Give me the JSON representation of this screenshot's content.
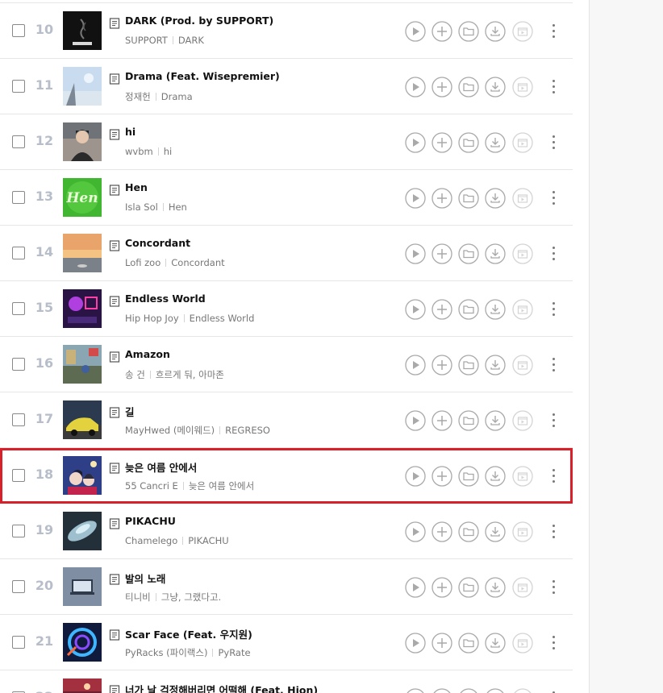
{
  "songs": [
    {
      "rank": "10",
      "title": "DARK (Prod. by SUPPORT)",
      "artist": "SUPPORT",
      "album": "DARK",
      "cover": "dark"
    },
    {
      "rank": "11",
      "title": "Drama (Feat. Wisepremier)",
      "artist": "정재헌",
      "album": "Drama",
      "cover": "sky"
    },
    {
      "rank": "12",
      "title": "hi",
      "artist": "wvbm",
      "album": "hi",
      "cover": "portrait"
    },
    {
      "rank": "13",
      "title": "Hen",
      "artist": "Isla Sol",
      "album": "Hen",
      "cover": "hen",
      "cover_text": "Hen"
    },
    {
      "rank": "14",
      "title": "Concordant",
      "artist": "Lofi zoo",
      "album": "Concordant",
      "cover": "sunset"
    },
    {
      "rank": "15",
      "title": "Endless World",
      "artist": "Hip Hop Joy",
      "album": "Endless World",
      "cover": "neon"
    },
    {
      "rank": "16",
      "title": "Amazon",
      "artist": "송 건",
      "album": "흐르게 둬, 아마존",
      "cover": "street"
    },
    {
      "rank": "17",
      "title": "길",
      "artist": "MayHwed (메이웨드)",
      "album": "REGRESO",
      "cover": "car"
    },
    {
      "rank": "18",
      "title": "늦은 여름 안에서",
      "artist": "55 Cancri E",
      "album": "늦은 여름 안에서",
      "cover": "anime"
    },
    {
      "rank": "19",
      "title": "PIKACHU",
      "artist": "Chamelego",
      "album": "PIKACHU",
      "cover": "cloud"
    },
    {
      "rank": "20",
      "title": "발의 노래",
      "artist": "티니비",
      "album": "그냥, 그랬다고.",
      "cover": "screen"
    },
    {
      "rank": "21",
      "title": "Scar Face (Feat. 우지원)",
      "artist": "PyRacks (파이랙스)",
      "album": "PyRate",
      "cover": "swirl"
    },
    {
      "rank": "22",
      "title": "너가 날 걱정해버리면 어떡해 (Feat. Hion)",
      "artist": "",
      "album": "",
      "cover": "red"
    }
  ],
  "highlighted_rank": "18",
  "colors": {
    "highlight_border": "#d7202a",
    "rank_text": "#b7bec9",
    "icon_stroke": "#a9a9a9"
  },
  "icons": {
    "lyrics": "lyrics-icon",
    "play": "play-icon",
    "add": "add-icon",
    "folder": "folder-icon",
    "download": "download-icon",
    "mv": "music-video-icon",
    "more": "more-icon"
  }
}
